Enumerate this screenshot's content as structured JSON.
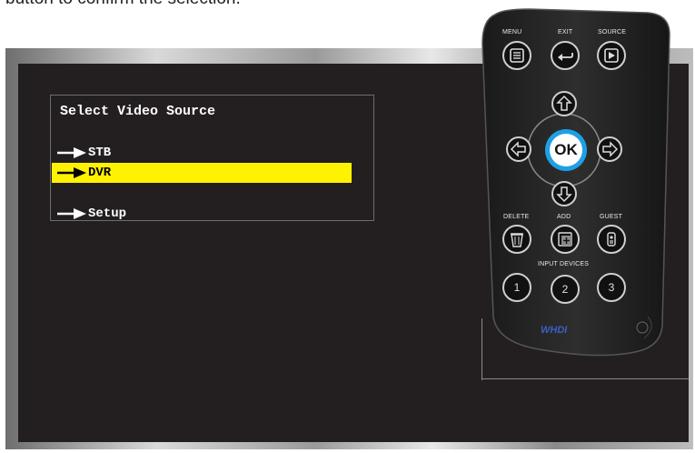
{
  "caption": "button to confirm the selection.",
  "menu": {
    "title": "Select Video Source",
    "items": [
      {
        "label": "STB",
        "selected": false
      },
      {
        "label": "DVR",
        "selected": true
      },
      {
        "label": "Setup",
        "selected": false
      }
    ],
    "highlight_color": "#fff200"
  },
  "remote": {
    "labels": {
      "menu": "MENU",
      "exit": "EXIT",
      "source": "SOURCE",
      "ok": "OK",
      "delete": "DELETE",
      "add": "ADD",
      "guest": "GUEST",
      "input_devices": "INPUT DEVICES",
      "dev1": "1",
      "dev2": "2",
      "dev3": "3",
      "logo": "WHDI"
    },
    "ok_ring_color": "#1ea0e6"
  }
}
